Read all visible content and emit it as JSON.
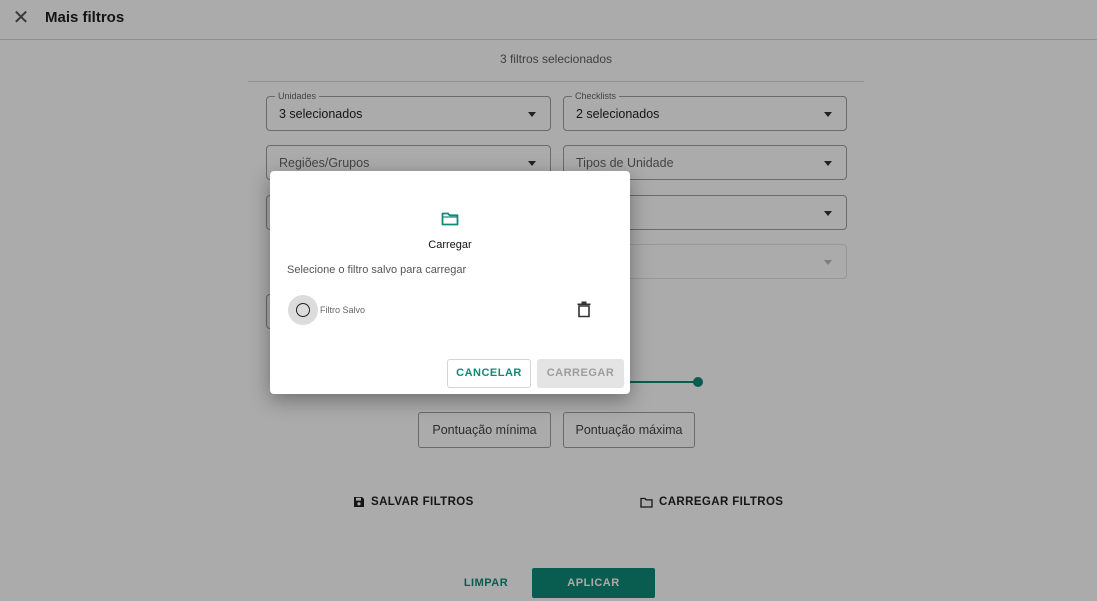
{
  "header": {
    "close_icon": "close-icon",
    "title": "Mais filtros"
  },
  "selection_count": "3 filtros selecionados",
  "filters": {
    "unidades": {
      "label": "Unidades",
      "value": "3 selecionados"
    },
    "checklists": {
      "label": "Checklists",
      "value": "2 selecionados"
    },
    "regioes": {
      "placeholder": "Regiões/Grupos"
    },
    "tipos_unidade": {
      "placeholder": "Tipos de Unidade"
    }
  },
  "score": {
    "min_label": "Pontuação mínima",
    "max_label": "Pontuação máxima"
  },
  "actions": {
    "save_label": "SALVAR FILTROS",
    "load_label": "CARREGAR FILTROS"
  },
  "footer": {
    "clear_label": "LIMPAR",
    "apply_label": "APLICAR"
  },
  "dialog": {
    "icon": "folder-icon",
    "title": "Carregar",
    "subtitle": "Selecione o filtro salvo para carregar",
    "items": [
      {
        "label": "Filtro Salvo",
        "selected": false
      }
    ],
    "cancel_label": "CANCELAR",
    "load_label": "CARREGAR",
    "load_enabled": false
  },
  "colors": {
    "accent": "#0d8a78",
    "overlay": "rgba(0,0,0,0.33)"
  }
}
